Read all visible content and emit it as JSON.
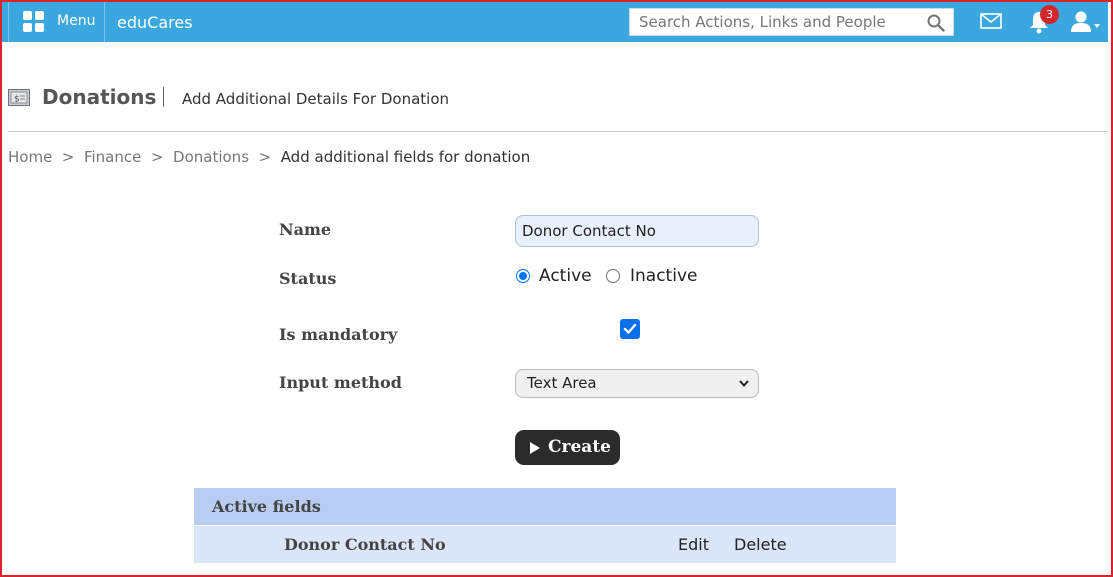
{
  "topbar": {
    "menu_label": "Menu",
    "app_name": "eduCares",
    "search_placeholder": "Search Actions, Links and People",
    "notification_count": "3",
    "color": "#3aa7de"
  },
  "header": {
    "title": "Donations",
    "subtitle": "Add Additional Details For Donation"
  },
  "breadcrumb": {
    "items": [
      "Home",
      "Finance",
      "Donations"
    ],
    "current": "Add additional fields for donation",
    "separator": ">"
  },
  "form": {
    "name_label": "Name",
    "name_value": "Donor Contact No",
    "status_label": "Status",
    "status_options": [
      "Active",
      "Inactive"
    ],
    "status_selected": "Active",
    "mandatory_label": "Is mandatory",
    "mandatory_checked": true,
    "input_method_label": "Input method",
    "input_method_value": "Text Area",
    "create_label": "Create"
  },
  "table": {
    "header": "Active fields",
    "rows": [
      {
        "name": "Donor Contact No",
        "edit": "Edit",
        "delete": "Delete"
      }
    ]
  }
}
